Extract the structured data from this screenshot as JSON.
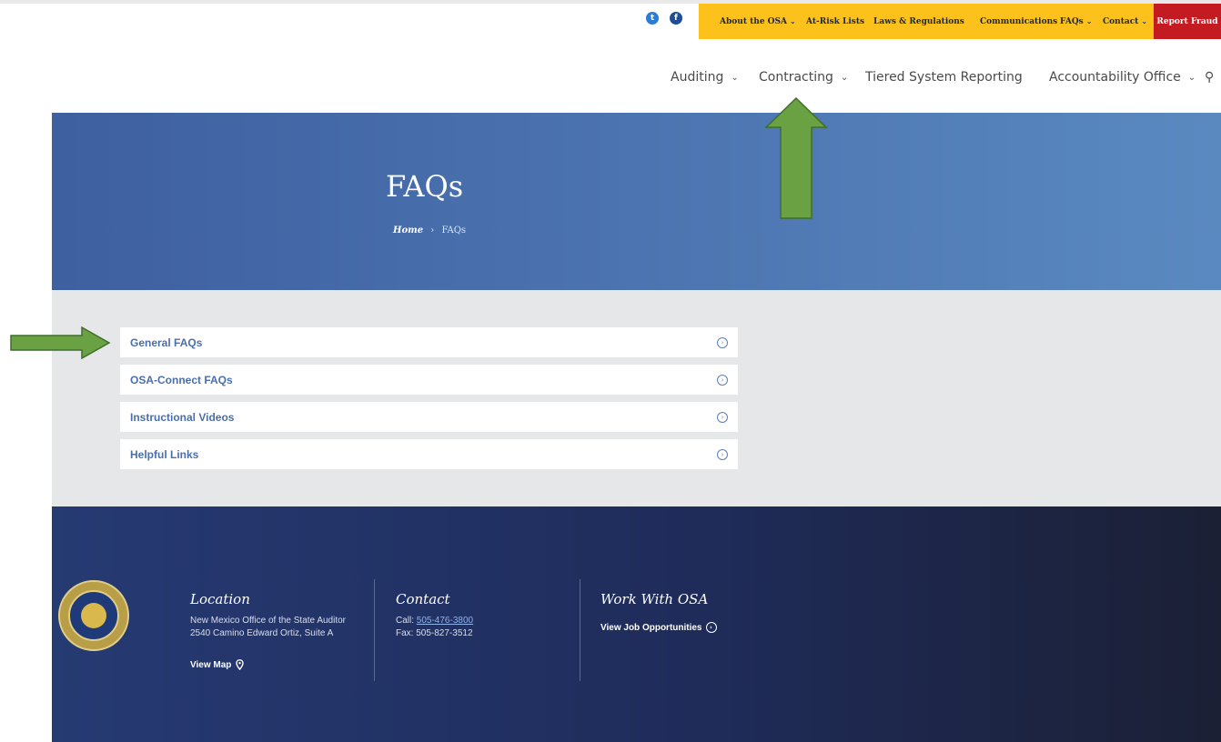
{
  "social": {
    "twitter_icon": "twitter-icon",
    "facebook_icon": "facebook-icon"
  },
  "utility_nav": {
    "items": [
      {
        "label": "About the OSA",
        "has_dropdown": true
      },
      {
        "label": "At-Risk Lists",
        "has_dropdown": false
      },
      {
        "label": "Laws & Regulations",
        "has_dropdown": false
      },
      {
        "label": "Communications",
        "has_dropdown": false
      },
      {
        "label": "FAQs",
        "has_dropdown": true
      },
      {
        "label": "Contact",
        "has_dropdown": true
      }
    ],
    "report_fraud": "Report Fraud",
    "chevron": "⌄"
  },
  "main_nav": {
    "items": [
      {
        "label": "Auditing"
      },
      {
        "label": "Contracting"
      },
      {
        "label": "Tiered System Reporting"
      },
      {
        "label": "Accountability Office"
      }
    ],
    "chevron": "⌄",
    "search_icon": "⚲"
  },
  "hero": {
    "title": "FAQs",
    "breadcrumb_home": "Home",
    "breadcrumb_sep": "›",
    "breadcrumb_current": "FAQs"
  },
  "faq_items": [
    {
      "label": "General FAQs"
    },
    {
      "label": "OSA-Connect FAQs"
    },
    {
      "label": "Instructional Videos"
    },
    {
      "label": "Helpful Links"
    }
  ],
  "faq_icon_glyph": "›",
  "footer": {
    "location": {
      "heading": "Location",
      "line1": "New Mexico Office of the State Auditor",
      "line2": "2540 Camino Edward Ortiz, Suite A",
      "map_label": "View Map"
    },
    "contact": {
      "heading": "Contact",
      "call_prefix": "Call: ",
      "phone": "505-476-3800",
      "fax": "Fax: 505-827-3512"
    },
    "work": {
      "heading": "Work With OSA",
      "jobs_label": "View Job Opportunities"
    }
  },
  "colors": {
    "utility_bar": "#fcc21b",
    "report_fraud": "#c41a22",
    "hero_start": "#3e5fa0",
    "hero_end": "#5a89c0",
    "faq_link": "#4a6fae",
    "footer_dark": "#1f2c5a",
    "annotation_arrow": "#6aa142"
  }
}
